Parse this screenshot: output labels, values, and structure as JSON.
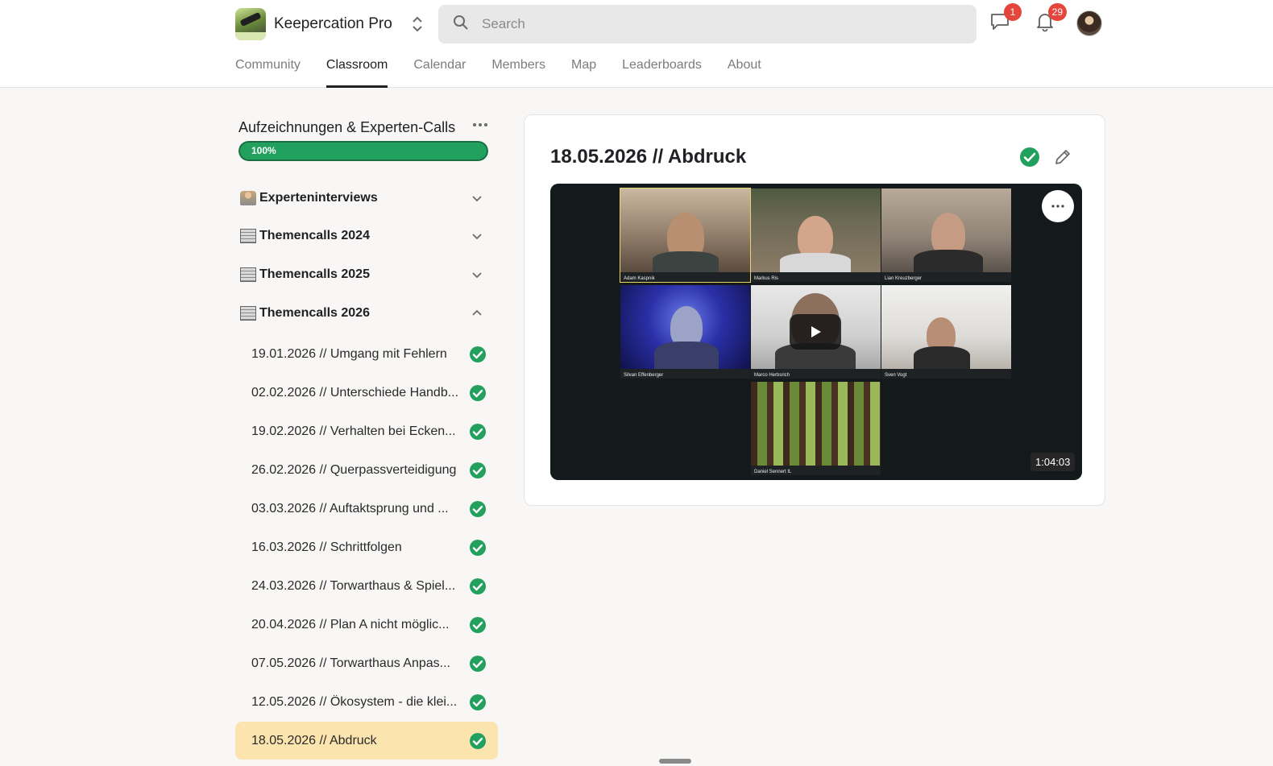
{
  "brand": {
    "name": "Keepercation Pro"
  },
  "search": {
    "placeholder": "Search"
  },
  "header": {
    "chat_badge": "1",
    "notifications_badge": "29"
  },
  "tabs": [
    {
      "label": "Community"
    },
    {
      "label": "Classroom"
    },
    {
      "label": "Calendar"
    },
    {
      "label": "Members"
    },
    {
      "label": "Map"
    },
    {
      "label": "Leaderboards"
    },
    {
      "label": "About"
    }
  ],
  "course": {
    "title": "Aufzeichnungen & Experten-Calls",
    "progress_label": "100%",
    "progress_fraction": 1.0
  },
  "sections": [
    {
      "label": "Experteninterviews",
      "expanded": false
    },
    {
      "label": "Themencalls 2024",
      "expanded": false
    },
    {
      "label": "Themencalls 2025",
      "expanded": false
    },
    {
      "label": "Themencalls 2026",
      "expanded": true
    }
  ],
  "lessons": [
    {
      "title": "19.01.2026 // Umgang mit Fehlern"
    },
    {
      "title": "02.02.2026 // Unterschiede Handb..."
    },
    {
      "title": "19.02.2026 // Verhalten bei Ecken..."
    },
    {
      "title": "26.02.2026 // Querpassverteidigung"
    },
    {
      "title": "03.03.2026 // Auftaktsprung und ..."
    },
    {
      "title": "16.03.2026 // Schrittfolgen"
    },
    {
      "title": "24.03.2026 // Torwarthaus & Spiel..."
    },
    {
      "title": "20.04.2026 // Plan A nicht möglic..."
    },
    {
      "title": "07.05.2026 // Torwarthaus Anpas..."
    },
    {
      "title": "12.05.2026 // Ökosystem - die klei..."
    },
    {
      "title": "18.05.2026 // Abdruck"
    }
  ],
  "main": {
    "lesson_title": "18.05.2026 // Abdruck",
    "video": {
      "duration": "1:04:03",
      "participants": [
        "Adam Kaspnik",
        "Markus Ris",
        "Lian Kreuzberger",
        "Silvan Effenberger",
        "Marco Herbsrich",
        "Sven Vogt",
        "Daniel Sennert IL"
      ]
    }
  },
  "colors": {
    "accent_green": "#21a15d",
    "active_lesson_bg": "#fbe4ae",
    "badge_red": "#e4463b"
  }
}
